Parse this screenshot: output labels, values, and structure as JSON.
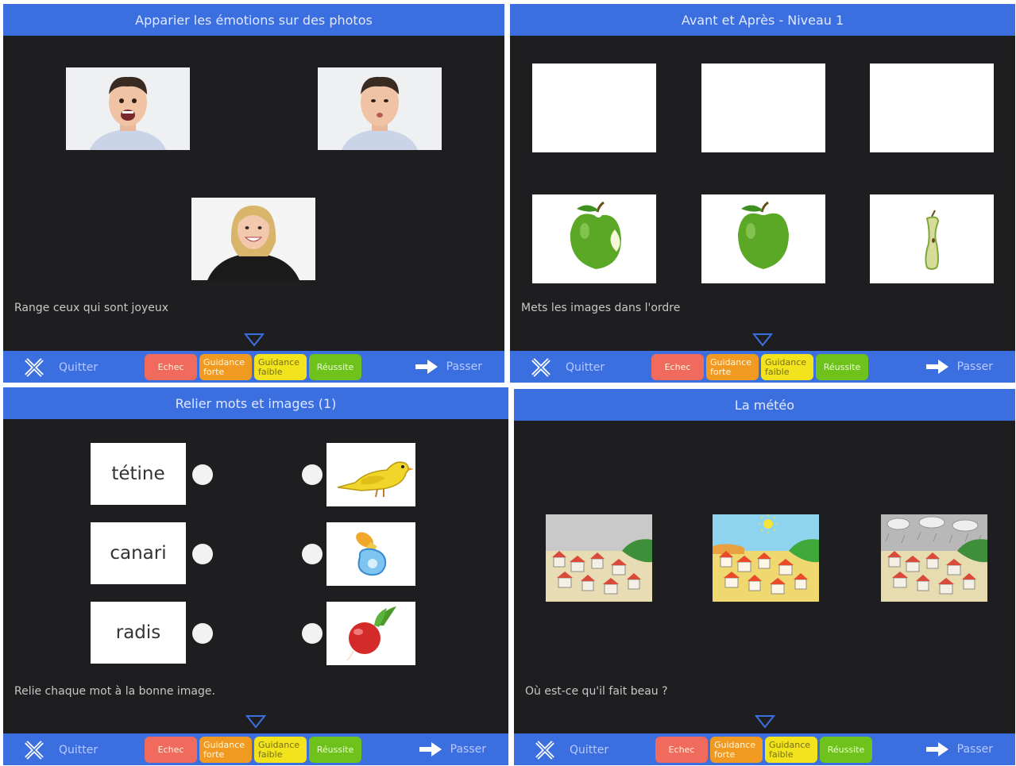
{
  "footer": {
    "quit_label": "Quitter",
    "pass_label": "Passer",
    "quit_icon": "quit-x-icon",
    "pass_icon": "arrow-right-icon",
    "buttons": {
      "echec": "Echec",
      "guidance_forte": "Guidance forte",
      "guidance_faible": "Guidance faible",
      "reussite": "Réussite"
    },
    "colors": {
      "bar": "#3b6fe0",
      "echec": "#f06a5e",
      "forte": "#f19a22",
      "faible": "#f2e31c",
      "reussite": "#6fc21b"
    }
  },
  "panel1": {
    "title": "Apparier les émotions sur des photos",
    "instruction": "Range ceux qui sont joyeux",
    "photos": [
      "photo-man-surprised",
      "photo-man-pouting",
      "photo-woman-smiling"
    ]
  },
  "panel2": {
    "title": "Avant et Après - Niveau 1",
    "instruction": "Mets les images dans l'ordre",
    "images": [
      "apple-bitten-icon",
      "apple-whole-icon",
      "apple-core-icon"
    ]
  },
  "panel3": {
    "title": "Relier mots et images (1)",
    "instruction": "Relie chaque mot à la bonne image.",
    "words": [
      "tétine",
      "canari",
      "radis"
    ],
    "images": [
      "canary-icon",
      "pacifier-icon",
      "radish-icon"
    ]
  },
  "panel4": {
    "title": "La météo",
    "instruction": "Où est-ce qu'il fait beau ?",
    "images": [
      "village-cloudy-icon",
      "village-sunny-icon",
      "village-rainy-icon"
    ]
  }
}
